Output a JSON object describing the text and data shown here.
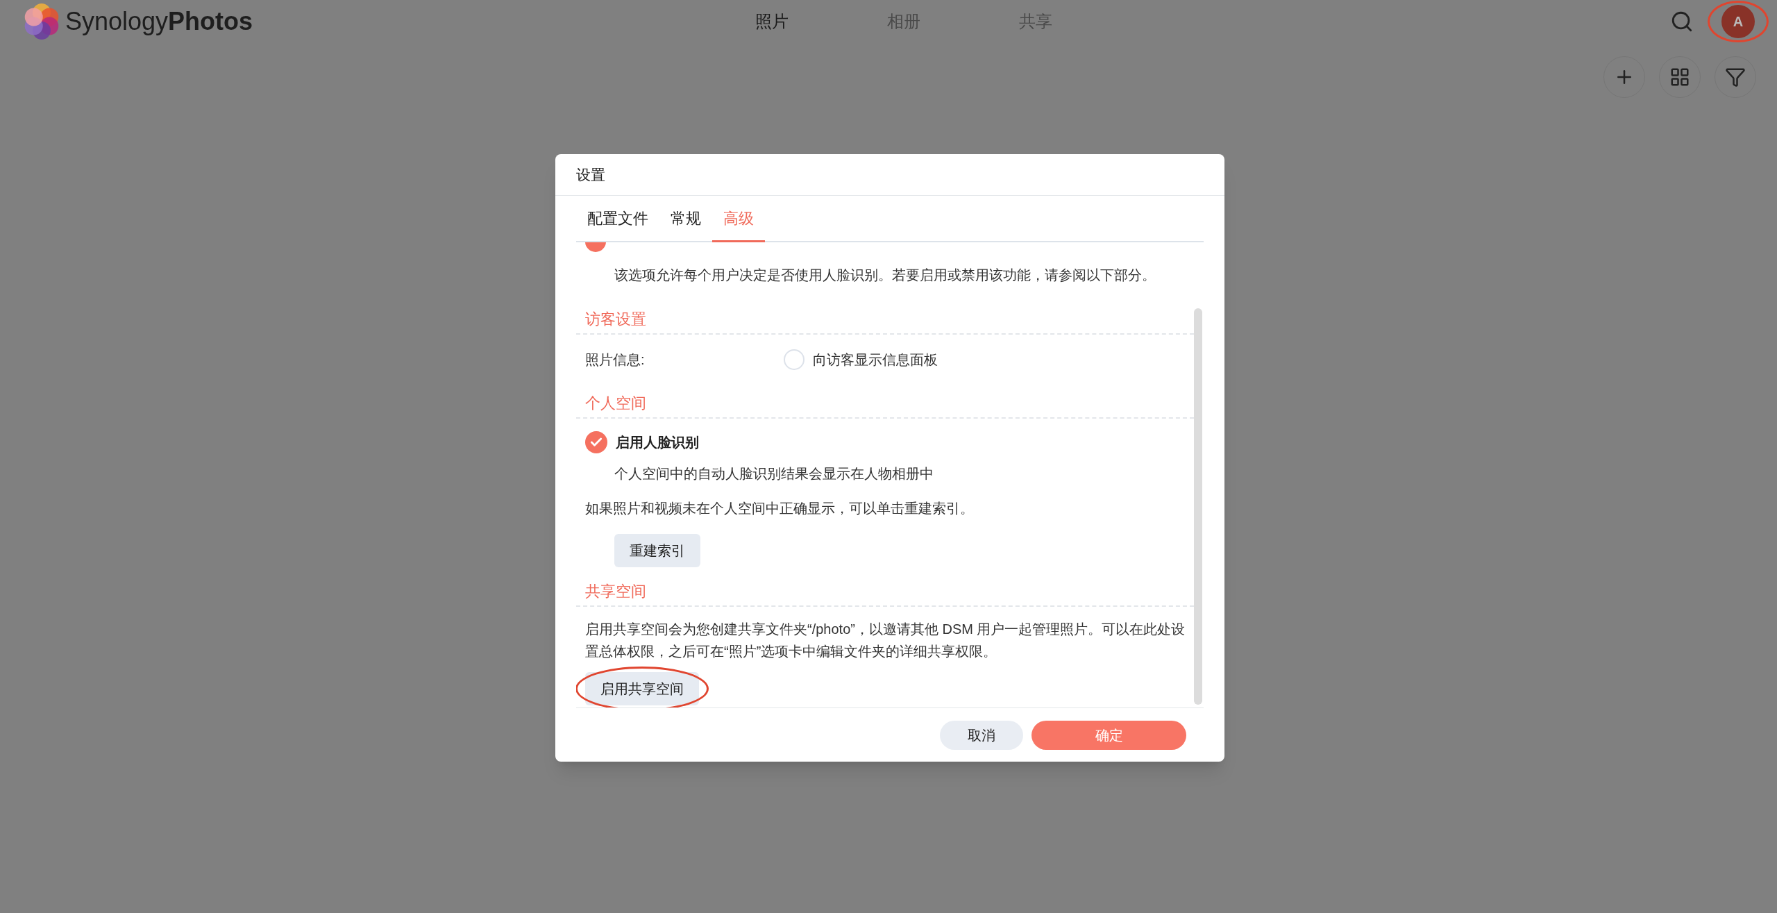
{
  "app": {
    "logo_light": "Synology",
    "logo_bold": "Photos"
  },
  "nav": [
    {
      "label": "照片",
      "selected": true
    },
    {
      "label": "相册",
      "selected": false
    },
    {
      "label": "共享",
      "selected": false
    }
  ],
  "avatar": {
    "initial": "A",
    "highlighted": true
  },
  "dialog": {
    "title": "设置",
    "tabs": [
      {
        "label": "配置文件",
        "selected": false
      },
      {
        "label": "常规",
        "selected": false
      },
      {
        "label": "高级",
        "selected": true
      }
    ],
    "intro": "该选项允许每个用户决定是否使用人脸识别。若要启用或禁用该功能，请参阅以下部分。",
    "sections": [
      {
        "kind": "guest",
        "title": "访客设置",
        "field_label": "照片信息:",
        "option": {
          "label": "向访客显示信息面板",
          "checked": false
        }
      },
      {
        "kind": "personal",
        "title": "个人空间",
        "option": {
          "label": "启用人脸识别",
          "checked": true
        },
        "option_note": "个人空间中的自动人脸识别结果会显示在人物相册中",
        "description": "如果照片和视频未在个人空间中正确显示，可以单击重建索引。",
        "button": {
          "label": "重建索引",
          "highlighted": false
        }
      },
      {
        "kind": "shared",
        "title": "共享空间",
        "description": "启用共享空间会为您创建共享文件夹“/photo”，以邀请其他 DSM 用户一起管理照片。可以在此处设置总体权限，之后可在“照片”选项卡中编辑文件夹的详细共享权限。",
        "button": {
          "label": "启用共享空间",
          "highlighted": true
        }
      }
    ],
    "buttons": {
      "cancel": "取消",
      "ok": "确定"
    }
  }
}
